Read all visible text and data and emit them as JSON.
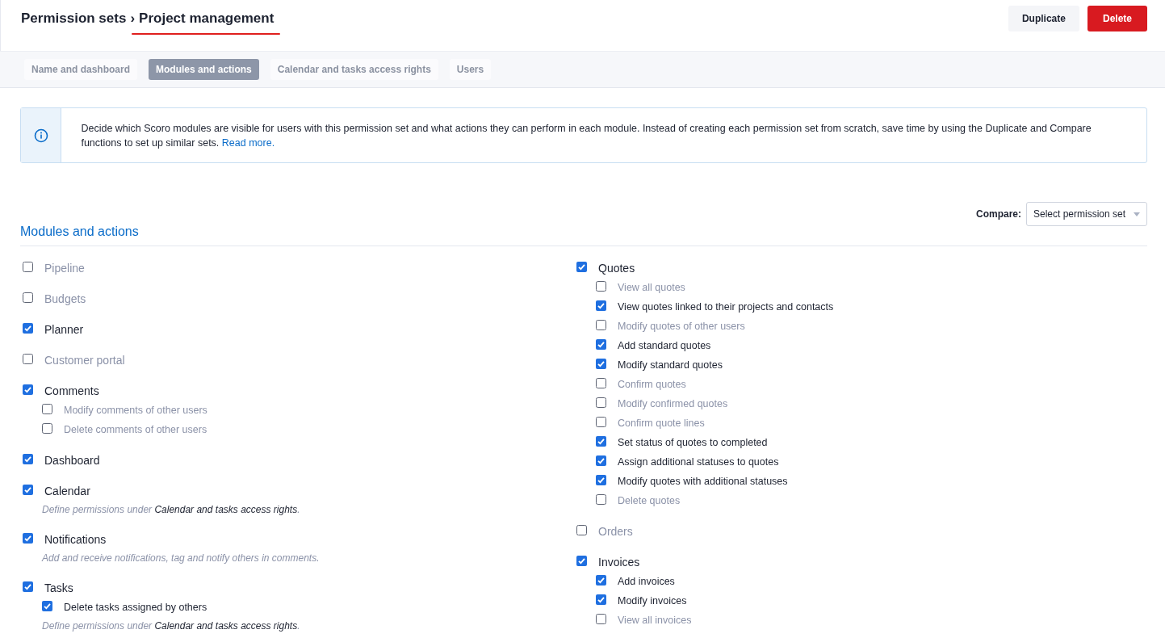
{
  "header": {
    "breadcrumb": "Permission sets",
    "separator": "›",
    "current": "Project management",
    "current_underlined": true,
    "buttons": [
      {
        "label": "Duplicate",
        "kind": "secondary"
      },
      {
        "label": "Delete",
        "kind": "danger"
      }
    ]
  },
  "tabs": [
    {
      "label": "Name and dashboard",
      "selected": false
    },
    {
      "label": "Modules and actions",
      "selected": true
    },
    {
      "label": "Calendar and tasks access rights",
      "selected": false
    },
    {
      "label": "Users",
      "selected": false
    }
  ],
  "info": {
    "text": "Decide which Scoro modules are visible for users with this permission set and what actions they can perform in each module. Instead of creating each permission set from scratch, save time by using the Duplicate and Compare functions to set up similar sets.",
    "link": "Read more."
  },
  "compare": {
    "label": "Compare:",
    "placeholder": "Select permission set"
  },
  "section_title": "Modules and actions",
  "columns": [
    [
      {
        "label": "Pipeline",
        "checked": false
      },
      {
        "label": "Budgets",
        "checked": false
      },
      {
        "label": "Planner",
        "checked": true
      },
      {
        "label": "Customer portal",
        "checked": false
      },
      {
        "label": "Comments",
        "checked": true,
        "actions": [
          {
            "label": "Modify comments of other users",
            "checked": false
          },
          {
            "label": "Delete comments of other users",
            "checked": false
          }
        ]
      },
      {
        "label": "Dashboard",
        "checked": true
      },
      {
        "label": "Calendar",
        "checked": true,
        "note": {
          "text": "Define permissions under ",
          "link": "Calendar and tasks access rights",
          "end": "."
        }
      },
      {
        "label": "Notifications",
        "checked": true,
        "note": {
          "text": "Add and receive notifications, tag and notify others in comments."
        }
      },
      {
        "label": "Tasks",
        "checked": true,
        "actions": [
          {
            "label": "Delete tasks assigned by others",
            "checked": true
          }
        ],
        "note": {
          "text": "Define permissions under ",
          "link": "Calendar and tasks access rights",
          "end": "."
        }
      }
    ],
    [
      {
        "label": "Quotes",
        "checked": true,
        "actions": [
          {
            "label": "View all quotes",
            "checked": false
          },
          {
            "label": "View quotes linked to their projects and contacts",
            "checked": true
          },
          {
            "label": "Modify quotes of other users",
            "checked": false
          },
          {
            "label": "Add standard quotes",
            "checked": true
          },
          {
            "label": "Modify standard quotes",
            "checked": true
          },
          {
            "label": "Confirm quotes",
            "checked": false
          },
          {
            "label": "Modify confirmed quotes",
            "checked": false
          },
          {
            "label": "Confirm quote lines",
            "checked": false
          },
          {
            "label": "Set status of quotes to completed",
            "checked": true
          },
          {
            "label": "Assign additional statuses to quotes",
            "checked": true
          },
          {
            "label": "Modify quotes with additional statuses",
            "checked": true
          },
          {
            "label": "Delete quotes",
            "checked": false
          }
        ]
      },
      {
        "label": "Orders",
        "checked": false
      },
      {
        "label": "Invoices",
        "checked": true,
        "actions": [
          {
            "label": "Add invoices",
            "checked": true
          },
          {
            "label": "Modify invoices",
            "checked": true
          },
          {
            "label": "View all invoices",
            "checked": false
          }
        ]
      }
    ]
  ]
}
